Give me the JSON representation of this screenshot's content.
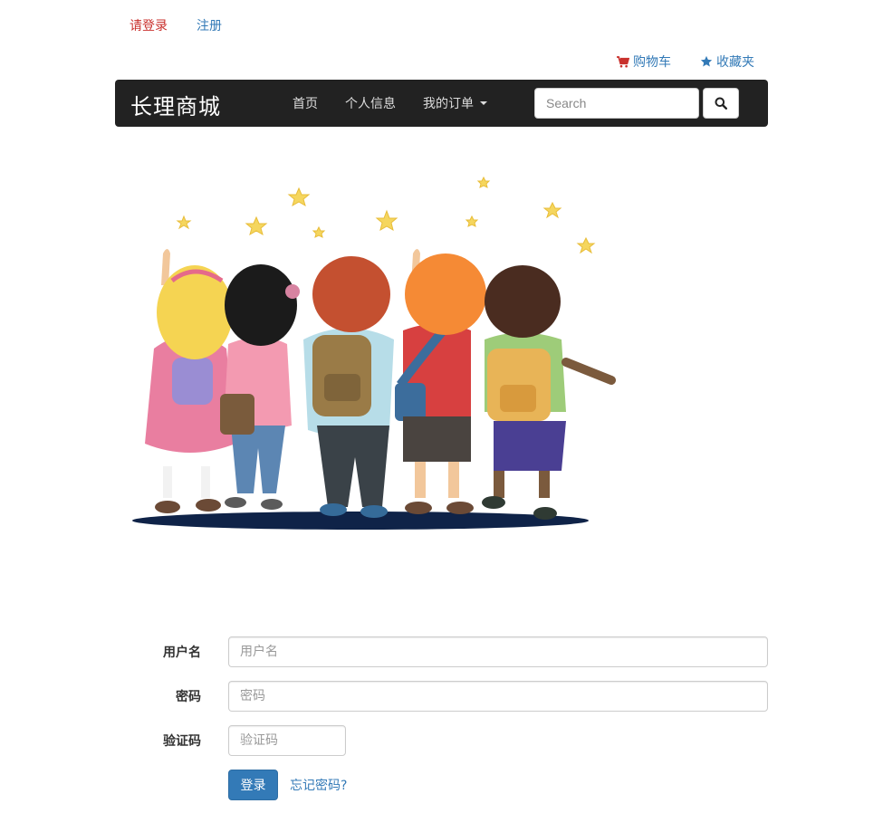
{
  "top_links": {
    "login": "请登录",
    "register": "注册"
  },
  "user_links": {
    "cart": "购物车",
    "favorites": "收藏夹"
  },
  "navbar": {
    "brand": "长理商城",
    "items": [
      "首页",
      "个人信息",
      "我的订单"
    ],
    "search_placeholder": "Search"
  },
  "form": {
    "username_label": "用户名",
    "username_placeholder": "用户名",
    "password_label": "密码",
    "password_placeholder": "密码",
    "captcha_label": "验证码",
    "captcha_placeholder": "验证码",
    "login_button": "登录",
    "forgot_password": "忘记密码?"
  },
  "colors": {
    "navbar_bg": "#222222",
    "primary": "#337ab7",
    "login_link": "#c9302c"
  }
}
